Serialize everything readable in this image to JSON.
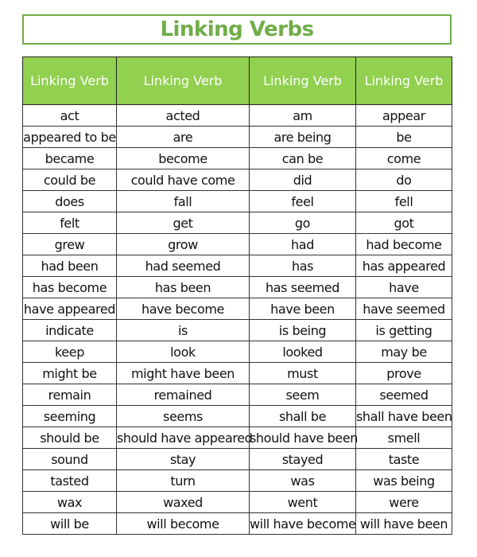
{
  "title": "Linking Verbs",
  "colors": {
    "title_green": "#70ad47",
    "header_green": "#92d050"
  },
  "table": {
    "headers": [
      "Linking Verb",
      "Linking Verb",
      "Linking Verb",
      "Linking Verb"
    ],
    "rows": [
      [
        "act",
        "acted",
        "am",
        "appear"
      ],
      [
        "appeared to be",
        "are",
        "are being",
        "be"
      ],
      [
        "became",
        "become",
        "can be",
        "come"
      ],
      [
        "could be",
        "could have come",
        "did",
        "do"
      ],
      [
        "does",
        "fall",
        "feel",
        "fell"
      ],
      [
        "felt",
        "get",
        "go",
        "got"
      ],
      [
        "grew",
        "grow",
        "had",
        "had become"
      ],
      [
        "had been",
        "had seemed",
        "has",
        "has appeared"
      ],
      [
        "has become",
        "has been",
        "has seemed",
        "have"
      ],
      [
        "have appeared",
        "have become",
        "have been",
        "have seemed"
      ],
      [
        "indicate",
        "is",
        "is being",
        "is getting"
      ],
      [
        "keep",
        "look",
        "looked",
        "may be"
      ],
      [
        "might be",
        "might have been",
        "must",
        "prove"
      ],
      [
        "remain",
        "remained",
        "seem",
        "seemed"
      ],
      [
        "seeming",
        "seems",
        "shall be",
        "shall have been"
      ],
      [
        "should be",
        "should have appeared",
        "should have been",
        "smell"
      ],
      [
        "sound",
        "stay",
        "stayed",
        "taste"
      ],
      [
        "tasted",
        "turn",
        "was",
        "was being"
      ],
      [
        "wax",
        "waxed",
        "went",
        "were"
      ],
      [
        "will be",
        "will become",
        "will have become",
        "will have been"
      ]
    ]
  }
}
